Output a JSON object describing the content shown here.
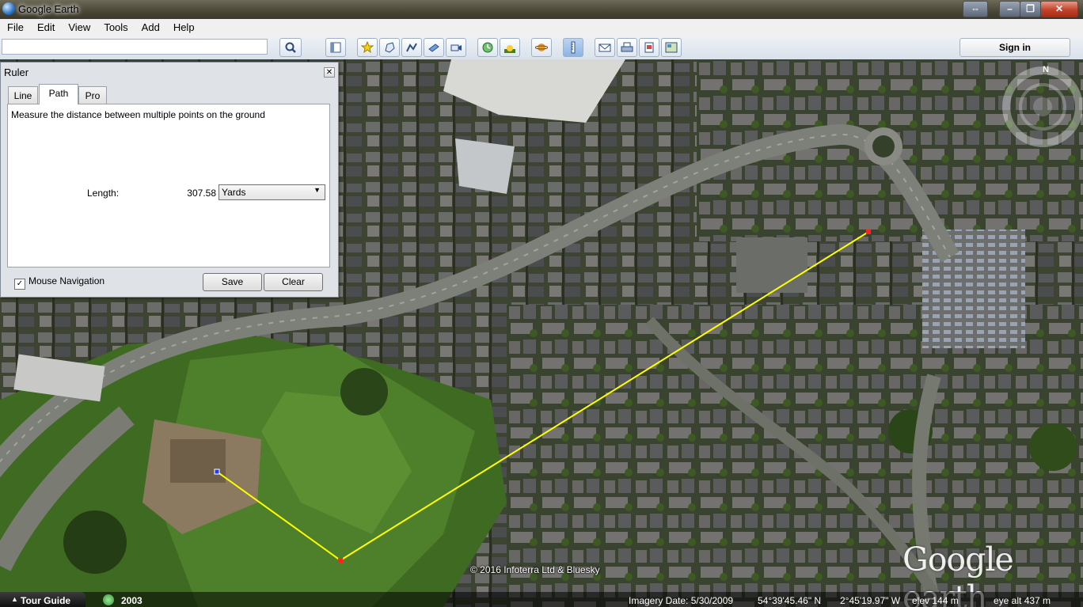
{
  "window": {
    "title": "Google Earth"
  },
  "menu": [
    "File",
    "Edit",
    "View",
    "Tools",
    "Add",
    "Help"
  ],
  "toolbar": {
    "search_value": "",
    "sign_in_label": "Sign in",
    "icons": [
      "search-icon",
      "hide-sidebar-icon",
      "add-placemark-icon",
      "add-polygon-icon",
      "add-path-icon",
      "add-overlay-icon",
      "record-tour-icon",
      "historical-imagery-icon",
      "sunlight-icon",
      "switch-planet-icon",
      "ruler-icon",
      "email-icon",
      "print-icon",
      "save-image-icon",
      "view-in-maps-icon"
    ]
  },
  "ruler": {
    "title": "Ruler",
    "tabs": [
      "Line",
      "Path",
      "Pro"
    ],
    "active_tab": "Path",
    "description": "Measure the distance between multiple points on the ground",
    "length_label": "Length:",
    "length_value": "307.58",
    "unit": "Yards",
    "mouse_navigation_label": "Mouse Navigation",
    "mouse_navigation_checked": true,
    "save_label": "Save",
    "clear_label": "Clear"
  },
  "map": {
    "copyright": "© 2016 Infoterra Ltd & Bluesky",
    "logo": "Google earth",
    "compass_north": "N",
    "path_color": "#ffff00"
  },
  "statusbar": {
    "tour_guide": "Tour Guide",
    "year": "2003",
    "imagery_date": "Imagery Date: 5/30/2009",
    "lat": "54°39'45.46\" N",
    "lon": "2°45'19.97\" W",
    "elev": "elev 144 m",
    "eye_alt": "eye alt 437 m"
  }
}
